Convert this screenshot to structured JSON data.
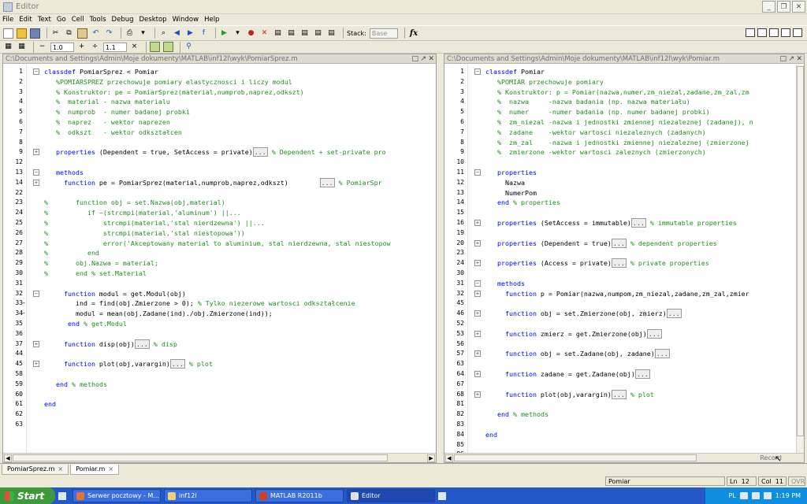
{
  "window": {
    "title": "Editor"
  },
  "menu": [
    "File",
    "Edit",
    "Text",
    "Go",
    "Cell",
    "Tools",
    "Debug",
    "Desktop",
    "Window",
    "Help"
  ],
  "toolbar": {
    "stack_label": "Stack:",
    "stack_value": "Base",
    "fx_label": "fx",
    "cell_minus": "−",
    "cell_value1": "1.0",
    "cell_plus": "+",
    "cell_div": "÷",
    "cell_value2": "1.1",
    "cell_times": "×"
  },
  "left_pane": {
    "path": "C:\\Documents and Settings\\Admin\\Moje dokumenty\\MATLAB\\inf12l\\wyk\\PomiarSprez.m",
    "lines": [
      {
        "n": "1",
        "f": "m",
        "segs": [
          {
            "c": "kw",
            "t": "classdef"
          },
          {
            "c": "",
            "t": " PomiarSprez < Pomiar"
          }
        ]
      },
      {
        "n": "2",
        "segs": [
          {
            "c": "cm",
            "t": "   %POMIARSPREZ przechowuje pomiary elastycznosci i liczy modul"
          }
        ]
      },
      {
        "n": "3",
        "segs": [
          {
            "c": "cm",
            "t": "   % Konstruktor: pe = PomiarSprez(material,numprob,naprez,odkszt)"
          }
        ]
      },
      {
        "n": "4",
        "segs": [
          {
            "c": "cm",
            "t": "   %  material - nazwa materialu"
          }
        ]
      },
      {
        "n": "5",
        "segs": [
          {
            "c": "cm",
            "t": "   %  numprob  - numer badanej probki"
          }
        ]
      },
      {
        "n": "6",
        "segs": [
          {
            "c": "cm",
            "t": "   %  naprez   - wektor naprezen"
          }
        ]
      },
      {
        "n": "7",
        "segs": [
          {
            "c": "cm",
            "t": "   %  odkszt   - wektor odkształcen"
          }
        ]
      },
      {
        "n": "8",
        "segs": []
      },
      {
        "n": "9",
        "f": "p",
        "segs": [
          {
            "c": "kw",
            "t": "   properties"
          },
          {
            "c": "",
            "t": " (Dependent = true, SetAccess = private)"
          },
          {
            "c": "el",
            "t": "..."
          },
          {
            "c": "cm",
            "t": " % Dependent + set-private pro"
          }
        ]
      },
      {
        "n": "12",
        "segs": []
      },
      {
        "n": "13",
        "f": "m",
        "segs": [
          {
            "c": "kw",
            "t": "   methods"
          }
        ]
      },
      {
        "n": "14",
        "f": "p",
        "segs": [
          {
            "c": "kw",
            "t": "     function"
          },
          {
            "c": "",
            "t": " pe = PomiarSprez(material,numprob,naprez,odkszt)        "
          },
          {
            "c": "el",
            "t": "..."
          },
          {
            "c": "cm",
            "t": " % PomiarSpr"
          }
        ]
      },
      {
        "n": "22",
        "segs": []
      },
      {
        "n": "23",
        "segs": [
          {
            "c": "cm",
            "t": "%       function obj = set.Nazwa(obj,material)"
          }
        ]
      },
      {
        "n": "24",
        "segs": [
          {
            "c": "cm",
            "t": "%          if ~(strcmpi(material,'aluminum') ||..."
          }
        ]
      },
      {
        "n": "25",
        "segs": [
          {
            "c": "cm",
            "t": "%              strcmpi(material,'stal nierdzewna') ||..."
          }
        ]
      },
      {
        "n": "26",
        "segs": [
          {
            "c": "cm",
            "t": "%              strcmpi(material,'stal niestopowa'))"
          }
        ]
      },
      {
        "n": "27",
        "segs": [
          {
            "c": "cm",
            "t": "%              error('Akceptowany material to aluminium, stal nierdzewna, stal niestopow"
          }
        ]
      },
      {
        "n": "28",
        "segs": [
          {
            "c": "cm",
            "t": "%          end"
          }
        ]
      },
      {
        "n": "29",
        "segs": [
          {
            "c": "cm",
            "t": "%       obj.Nazwa = material;"
          }
        ]
      },
      {
        "n": "30",
        "segs": [
          {
            "c": "cm",
            "t": "%       end % set.Material"
          }
        ]
      },
      {
        "n": "31",
        "segs": []
      },
      {
        "n": "32",
        "f": "m",
        "segs": [
          {
            "c": "kw",
            "t": "     function"
          },
          {
            "c": "",
            "t": " modul = get.Modul(obj)"
          }
        ]
      },
      {
        "n": "33",
        "d": "1",
        "segs": [
          {
            "c": "",
            "t": "        ind = find(obj.Zmierzone > 0); "
          },
          {
            "c": "cm",
            "t": "% Tylko niezerowe wartosci odkształcenie"
          }
        ]
      },
      {
        "n": "34",
        "d": "1",
        "segs": [
          {
            "c": "",
            "t": "        modul = mean(obj.Zadane(ind)./obj.Zmierzone(ind));"
          }
        ]
      },
      {
        "n": "35",
        "segs": [
          {
            "c": "kw",
            "t": "      end"
          },
          {
            "c": "cm",
            "t": " % get.Modul"
          }
        ]
      },
      {
        "n": "36",
        "segs": []
      },
      {
        "n": "37",
        "f": "p",
        "segs": [
          {
            "c": "kw",
            "t": "     function"
          },
          {
            "c": "",
            "t": " disp(obj)"
          },
          {
            "c": "el",
            "t": "..."
          },
          {
            "c": "cm",
            "t": " % disp"
          }
        ]
      },
      {
        "n": "44",
        "segs": []
      },
      {
        "n": "45",
        "f": "p",
        "segs": [
          {
            "c": "kw",
            "t": "     function"
          },
          {
            "c": "",
            "t": " plot(obj,varargin)"
          },
          {
            "c": "el",
            "t": "..."
          },
          {
            "c": "cm",
            "t": " % plot"
          }
        ]
      },
      {
        "n": "58",
        "segs": []
      },
      {
        "n": "59",
        "segs": [
          {
            "c": "kw",
            "t": "   end"
          },
          {
            "c": "cm",
            "t": " % methods"
          }
        ]
      },
      {
        "n": "60",
        "segs": []
      },
      {
        "n": "61",
        "segs": [
          {
            "c": "kw",
            "t": "end"
          }
        ]
      },
      {
        "n": "62",
        "segs": []
      },
      {
        "n": "63",
        "segs": []
      }
    ]
  },
  "right_pane": {
    "path": "C:\\Documents and Settings\\Admin\\Moje dokumenty\\MATLAB\\inf12l\\wyk\\Pomiar.m",
    "lines": [
      {
        "n": "1",
        "f": "m",
        "segs": [
          {
            "c": "kw",
            "t": "classdef"
          },
          {
            "c": "",
            "t": " Pomiar"
          }
        ]
      },
      {
        "n": "2",
        "segs": [
          {
            "c": "cm",
            "t": "   %POMIAR przechowuje pomiary"
          }
        ]
      },
      {
        "n": "3",
        "segs": [
          {
            "c": "cm",
            "t": "   % Konstruktor: p = Pomiar(nazwa,numer,zm_niezal,zadane,zm_zal,zm"
          }
        ]
      },
      {
        "n": "4",
        "segs": [
          {
            "c": "cm",
            "t": "   %  nazwa     -nazwa badania (np. nazwa materiału)"
          }
        ]
      },
      {
        "n": "5",
        "segs": [
          {
            "c": "cm",
            "t": "   %  numer     -numer badania (np. numer badanej probki)"
          }
        ]
      },
      {
        "n": "6",
        "segs": [
          {
            "c": "cm",
            "t": "   %  zm_niezal -nazwa i jednostki zmiennej niezaleznej (zadanej), n"
          }
        ]
      },
      {
        "n": "7",
        "segs": [
          {
            "c": "cm",
            "t": "   %  zadane    -wektor wartosci niezaleznych (zadanych)"
          }
        ]
      },
      {
        "n": "8",
        "segs": [
          {
            "c": "cm",
            "t": "   %  zm_zal    -nazwa i jednostki zmiennej niezaleznej (zmierzonej"
          }
        ]
      },
      {
        "n": "9",
        "segs": [
          {
            "c": "cm",
            "t": "   %  zmierzone -wektor wartosci zaleznych (zmierzonych)"
          }
        ]
      },
      {
        "n": "10",
        "segs": []
      },
      {
        "n": "11",
        "f": "m",
        "segs": [
          {
            "c": "kw",
            "t": "   properties"
          }
        ]
      },
      {
        "n": "12",
        "segs": [
          {
            "c": "",
            "t": "     Nazwa"
          }
        ]
      },
      {
        "n": "13",
        "segs": [
          {
            "c": "",
            "t": "     NumerPom"
          }
        ]
      },
      {
        "n": "14",
        "segs": [
          {
            "c": "kw",
            "t": "   end"
          },
          {
            "c": "cm",
            "t": " % properties"
          }
        ]
      },
      {
        "n": "15",
        "segs": []
      },
      {
        "n": "16",
        "f": "p",
        "segs": [
          {
            "c": "kw",
            "t": "   properties"
          },
          {
            "c": "",
            "t": " (SetAccess = immutable)"
          },
          {
            "c": "el",
            "t": "..."
          },
          {
            "c": "cm",
            "t": " % immutable properties"
          }
        ]
      },
      {
        "n": "19",
        "segs": []
      },
      {
        "n": "20",
        "f": "p",
        "segs": [
          {
            "c": "kw",
            "t": "   properties"
          },
          {
            "c": "",
            "t": " (Dependent = true)"
          },
          {
            "c": "el",
            "t": "..."
          },
          {
            "c": "cm",
            "t": " % dependent properties"
          }
        ]
      },
      {
        "n": "23",
        "segs": []
      },
      {
        "n": "24",
        "f": "p",
        "segs": [
          {
            "c": "kw",
            "t": "   properties"
          },
          {
            "c": "",
            "t": " (Access = private)"
          },
          {
            "c": "el",
            "t": "..."
          },
          {
            "c": "cm",
            "t": " % private properties"
          }
        ]
      },
      {
        "n": "30",
        "segs": []
      },
      {
        "n": "31",
        "f": "m",
        "segs": [
          {
            "c": "kw",
            "t": "   methods"
          }
        ]
      },
      {
        "n": "32",
        "f": "p",
        "segs": [
          {
            "c": "kw",
            "t": "     function"
          },
          {
            "c": "",
            "t": " p = Pomiar(nazwa,numpom,zm_niezal,zadane,zm_zal,zmier"
          }
        ]
      },
      {
        "n": "45",
        "segs": []
      },
      {
        "n": "46",
        "f": "p",
        "segs": [
          {
            "c": "kw",
            "t": "     function"
          },
          {
            "c": "",
            "t": " obj = set.Zmierzone(obj, zmierz)"
          },
          {
            "c": "el",
            "t": "..."
          }
        ]
      },
      {
        "n": "52",
        "segs": []
      },
      {
        "n": "53",
        "f": "p",
        "segs": [
          {
            "c": "kw",
            "t": "     function"
          },
          {
            "c": "",
            "t": " zmierz = get.Zmierzone(obj)"
          },
          {
            "c": "el",
            "t": "..."
          }
        ]
      },
      {
        "n": "56",
        "segs": []
      },
      {
        "n": "57",
        "f": "p",
        "segs": [
          {
            "c": "kw",
            "t": "     function"
          },
          {
            "c": "",
            "t": " obj = set.Zadane(obj, zadane)"
          },
          {
            "c": "el",
            "t": "..."
          }
        ]
      },
      {
        "n": "63",
        "segs": []
      },
      {
        "n": "64",
        "f": "p",
        "segs": [
          {
            "c": "kw",
            "t": "     function"
          },
          {
            "c": "",
            "t": " zadane = get.Zadane(obj)"
          },
          {
            "c": "el",
            "t": "..."
          }
        ]
      },
      {
        "n": "67",
        "segs": []
      },
      {
        "n": "68",
        "f": "p",
        "segs": [
          {
            "c": "kw",
            "t": "     function"
          },
          {
            "c": "",
            "t": " plot(obj,varargin)"
          },
          {
            "c": "el",
            "t": "..."
          },
          {
            "c": "cm",
            "t": " % plot"
          }
        ]
      },
      {
        "n": "81",
        "segs": []
      },
      {
        "n": "82",
        "segs": [
          {
            "c": "kw",
            "t": "   end"
          },
          {
            "c": "cm",
            "t": " % methods"
          }
        ]
      },
      {
        "n": "83",
        "segs": []
      },
      {
        "n": "84",
        "segs": [
          {
            "c": "kw",
            "t": "end"
          }
        ]
      },
      {
        "n": "85",
        "segs": []
      },
      {
        "n": "86",
        "segs": []
      }
    ]
  },
  "file_tabs": [
    {
      "label": "PomiarSprez.m",
      "active": false
    },
    {
      "label": "Pomiar.m",
      "active": true
    }
  ],
  "tab_close": "×",
  "record_label": "Record",
  "statusbar": {
    "context": "Pomiar",
    "ln_label": "Ln",
    "ln_value": "12",
    "col_label": "Col",
    "col_value": "11",
    "ovr": "OVR"
  },
  "taskbar": {
    "start_label": "Start",
    "tasks": [
      {
        "label": "Serwer pocztowy - M...",
        "color": "#e87030"
      },
      {
        "label": "inf12l",
        "color": "#f0d070"
      },
      {
        "label": "MATLAB  R2011b",
        "color": "#d04020"
      },
      {
        "label": "Editor",
        "color": "#e0e0e0"
      }
    ],
    "lang": "PL",
    "clock": "1:19 PM"
  },
  "colors": {
    "keyword": "#0000ff",
    "comment": "#228b22"
  }
}
